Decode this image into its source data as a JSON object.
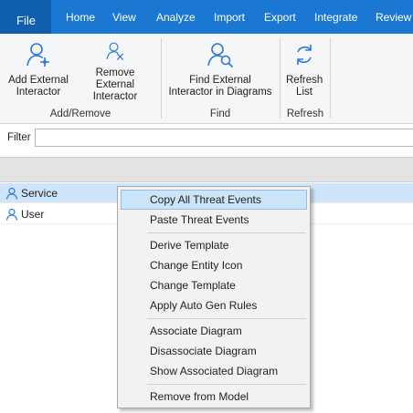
{
  "menubar": {
    "file": "File",
    "tabs": [
      "Home",
      "View",
      "Analyze",
      "Import",
      "Export",
      "Integrate",
      "Review"
    ]
  },
  "ribbon": {
    "add_external_interactor": "Add External Interactor",
    "remove_external_interactor": "Remove External Interactor",
    "group_add_remove": "Add/Remove",
    "find_in_diagrams": "Find External Interactor in Diagrams",
    "group_find": "Find",
    "refresh_list": "Refresh List",
    "group_refresh": "Refresh"
  },
  "filter": {
    "label": "Filter",
    "value": ""
  },
  "rows": [
    {
      "label": "Service",
      "selected": true
    },
    {
      "label": "User",
      "selected": false
    }
  ],
  "context_menu": {
    "items": [
      "Copy All Threat Events",
      "Paste Threat Events",
      "Derive Template",
      "Change Entity Icon",
      "Change Template",
      "Apply Auto Gen Rules",
      "Associate Diagram",
      "Disassociate Diagram",
      "Show Associated Diagram",
      "Remove from Model"
    ],
    "highlighted": "Copy All Threat Events"
  },
  "colors": {
    "menubar": "#1a78d2",
    "accent": "#2b7bd6",
    "selection": "#cde4fa"
  }
}
